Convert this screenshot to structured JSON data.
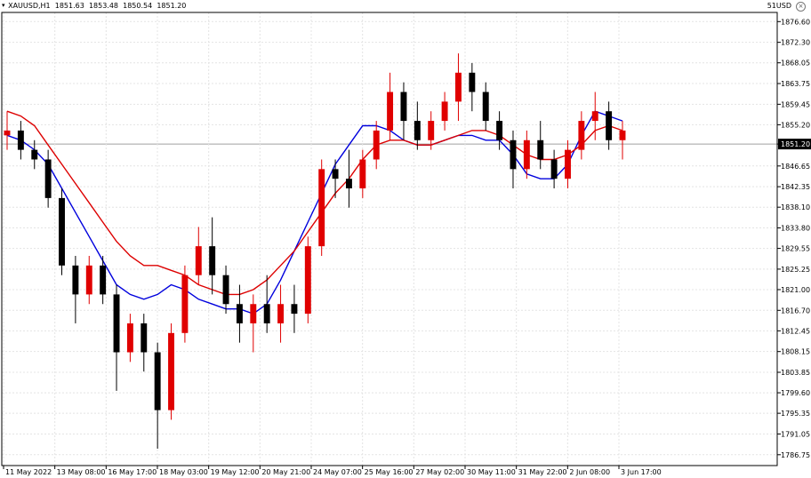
{
  "header": {
    "symbol": "XAUUSD,H1",
    "open": "1851.63",
    "high": "1853.48",
    "low": "1850.54",
    "close": "1851.20",
    "indicator_label": "51USD",
    "dropdown_icon": "triangle-down-icon",
    "close_icon": "close-icon"
  },
  "chart_data": {
    "type": "candlestick",
    "ylim": [
      1784.5,
      1878.5
    ],
    "y_ticks": [
      "1876.60",
      "1872.30",
      "1868.05",
      "1863.75",
      "1859.45",
      "1855.20",
      "1851.20",
      "1846.65",
      "1842.35",
      "1838.10",
      "1833.80",
      "1829.55",
      "1825.25",
      "1821.00",
      "1816.70",
      "1812.45",
      "1808.15",
      "1803.85",
      "1799.60",
      "1795.35",
      "1791.05",
      "1786.75"
    ],
    "x_ticks": [
      "11 May 2022",
      "13 May 08:00",
      "16 May 17:00",
      "18 May 03:00",
      "19 May 12:00",
      "20 May 21:00",
      "24 May 07:00",
      "25 May 16:00",
      "27 May 02:00",
      "30 May 11:00",
      "31 May 22:00",
      "2 Jun 08:00",
      "3 Jun 17:00"
    ],
    "current_price": 1851.2,
    "colors": {
      "bull": "#e00000",
      "bear": "#000000",
      "ma_fast": "#0000dd",
      "ma_slow": "#dd0000",
      "current_line": "#a0a0a0",
      "grid": "#e4e4e4"
    },
    "grid": true,
    "moving_averages": [
      {
        "period": 20,
        "values": [
          1853,
          1852,
          1850,
          1847,
          1842,
          1837,
          1832,
          1827,
          1822,
          1820,
          1819,
          1820,
          1822,
          1821,
          1819,
          1818,
          1817,
          1817,
          1816,
          1818,
          1823,
          1829,
          1835,
          1841,
          1847,
          1851,
          1855,
          1855,
          1854,
          1852,
          1851,
          1851,
          1852,
          1853,
          1853,
          1852,
          1852,
          1849,
          1845,
          1844,
          1844,
          1847,
          1853,
          1858,
          1857,
          1856
        ]
      },
      {
        "period": 50,
        "values": [
          1858,
          1857,
          1855,
          1851,
          1847,
          1843,
          1839,
          1835,
          1831,
          1828,
          1826,
          1826,
          1825,
          1824,
          1822,
          1821,
          1820,
          1820,
          1821,
          1823,
          1826,
          1829,
          1833,
          1837,
          1841,
          1844,
          1848,
          1851,
          1852,
          1852,
          1851,
          1851,
          1852,
          1853,
          1854,
          1854,
          1853,
          1851,
          1849,
          1848,
          1848,
          1849,
          1851,
          1854,
          1855,
          1854
        ]
      }
    ],
    "candles": [
      {
        "o": 1853,
        "h": 1858,
        "l": 1850,
        "c": 1854
      },
      {
        "o": 1854,
        "h": 1856,
        "l": 1848,
        "c": 1850
      },
      {
        "o": 1850,
        "h": 1852,
        "l": 1846,
        "c": 1848
      },
      {
        "o": 1848,
        "h": 1850,
        "l": 1838,
        "c": 1840
      },
      {
        "o": 1840,
        "h": 1842,
        "l": 1824,
        "c": 1826
      },
      {
        "o": 1826,
        "h": 1828,
        "l": 1814,
        "c": 1820
      },
      {
        "o": 1820,
        "h": 1828,
        "l": 1818,
        "c": 1826
      },
      {
        "o": 1826,
        "h": 1828,
        "l": 1818,
        "c": 1820
      },
      {
        "o": 1820,
        "h": 1822,
        "l": 1800,
        "c": 1808
      },
      {
        "o": 1808,
        "h": 1816,
        "l": 1806,
        "c": 1814
      },
      {
        "o": 1814,
        "h": 1816,
        "l": 1804,
        "c": 1808
      },
      {
        "o": 1808,
        "h": 1810,
        "l": 1788,
        "c": 1796
      },
      {
        "o": 1796,
        "h": 1814,
        "l": 1794,
        "c": 1812
      },
      {
        "o": 1812,
        "h": 1826,
        "l": 1810,
        "c": 1824
      },
      {
        "o": 1824,
        "h": 1834,
        "l": 1822,
        "c": 1830
      },
      {
        "o": 1830,
        "h": 1836,
        "l": 1820,
        "c": 1824
      },
      {
        "o": 1824,
        "h": 1826,
        "l": 1816,
        "c": 1818
      },
      {
        "o": 1818,
        "h": 1822,
        "l": 1810,
        "c": 1814
      },
      {
        "o": 1814,
        "h": 1820,
        "l": 1808,
        "c": 1818
      },
      {
        "o": 1818,
        "h": 1824,
        "l": 1812,
        "c": 1814
      },
      {
        "o": 1814,
        "h": 1822,
        "l": 1810,
        "c": 1818
      },
      {
        "o": 1818,
        "h": 1822,
        "l": 1812,
        "c": 1816
      },
      {
        "o": 1816,
        "h": 1832,
        "l": 1814,
        "c": 1830
      },
      {
        "o": 1830,
        "h": 1848,
        "l": 1828,
        "c": 1846
      },
      {
        "o": 1846,
        "h": 1848,
        "l": 1840,
        "c": 1844
      },
      {
        "o": 1844,
        "h": 1850,
        "l": 1838,
        "c": 1842
      },
      {
        "o": 1842,
        "h": 1850,
        "l": 1840,
        "c": 1848
      },
      {
        "o": 1848,
        "h": 1856,
        "l": 1846,
        "c": 1854
      },
      {
        "o": 1854,
        "h": 1866,
        "l": 1852,
        "c": 1862
      },
      {
        "o": 1862,
        "h": 1864,
        "l": 1852,
        "c": 1856
      },
      {
        "o": 1856,
        "h": 1860,
        "l": 1850,
        "c": 1852
      },
      {
        "o": 1852,
        "h": 1858,
        "l": 1850,
        "c": 1856
      },
      {
        "o": 1856,
        "h": 1862,
        "l": 1854,
        "c": 1860
      },
      {
        "o": 1860,
        "h": 1870,
        "l": 1856,
        "c": 1866
      },
      {
        "o": 1866,
        "h": 1868,
        "l": 1858,
        "c": 1862
      },
      {
        "o": 1862,
        "h": 1864,
        "l": 1854,
        "c": 1856
      },
      {
        "o": 1856,
        "h": 1858,
        "l": 1850,
        "c": 1852
      },
      {
        "o": 1852,
        "h": 1854,
        "l": 1842,
        "c": 1846
      },
      {
        "o": 1846,
        "h": 1854,
        "l": 1844,
        "c": 1852
      },
      {
        "o": 1852,
        "h": 1856,
        "l": 1846,
        "c": 1848
      },
      {
        "o": 1848,
        "h": 1850,
        "l": 1842,
        "c": 1844
      },
      {
        "o": 1844,
        "h": 1852,
        "l": 1842,
        "c": 1850
      },
      {
        "o": 1850,
        "h": 1858,
        "l": 1848,
        "c": 1856
      },
      {
        "o": 1856,
        "h": 1862,
        "l": 1852,
        "c": 1858
      },
      {
        "o": 1858,
        "h": 1860,
        "l": 1850,
        "c": 1852
      },
      {
        "o": 1852,
        "h": 1856,
        "l": 1848,
        "c": 1854
      }
    ]
  }
}
